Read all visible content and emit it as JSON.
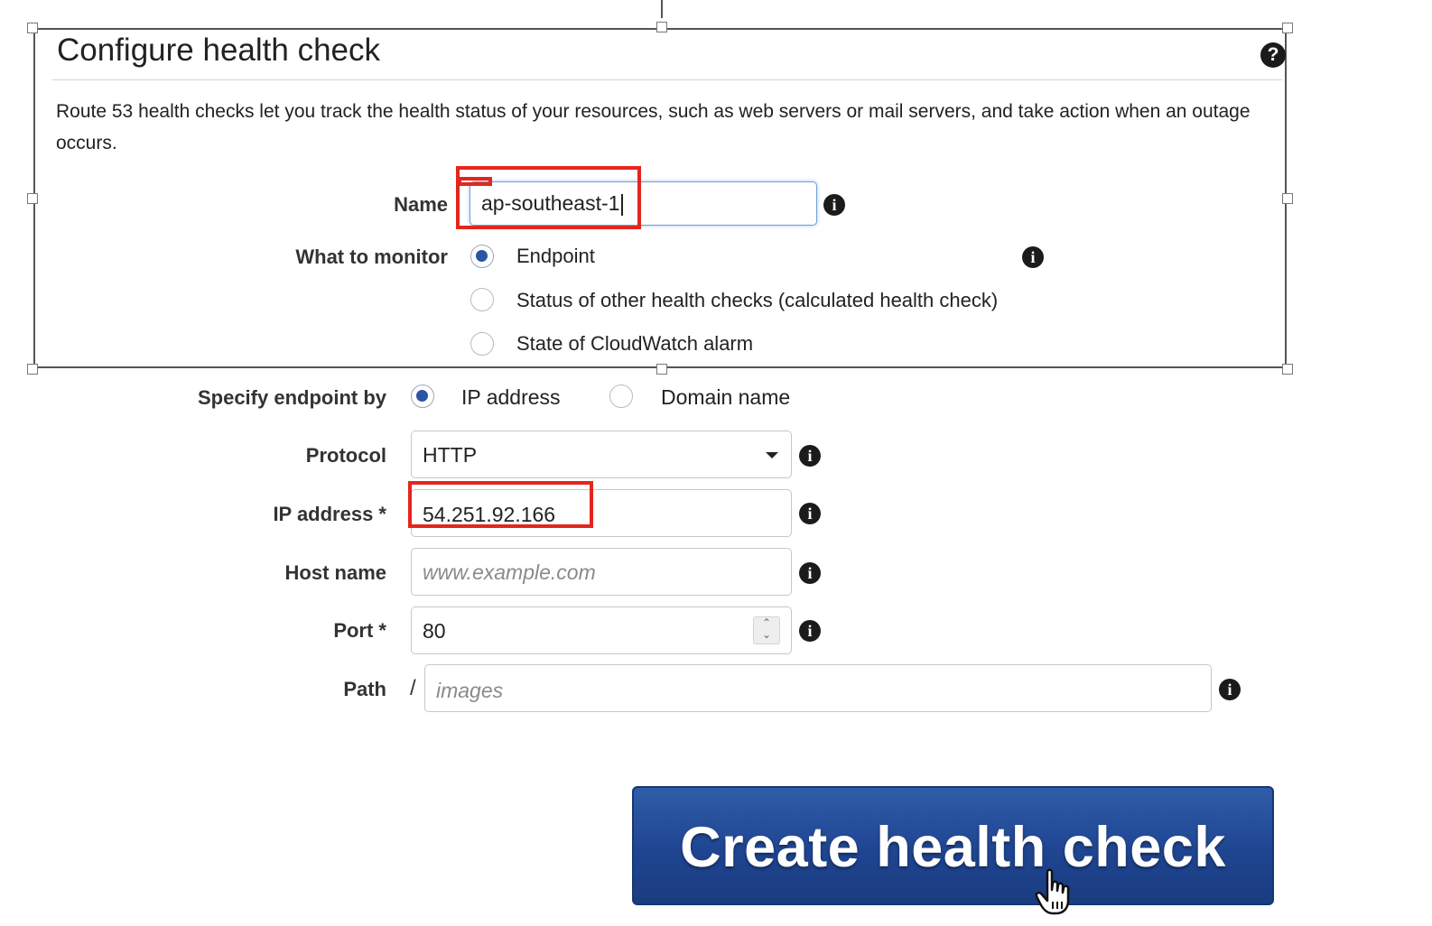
{
  "panel": {
    "title": "Configure health check",
    "description": "Route 53 health checks let you track the health status of your resources, such as web servers or mail servers, and take action when an outage occurs."
  },
  "form": {
    "name_label": "Name",
    "name_value": "ap-southeast-1",
    "monitor_label": "What to monitor",
    "monitor_options": [
      {
        "label": "Endpoint",
        "selected": true
      },
      {
        "label": "Status of other health checks (calculated health check)",
        "selected": false
      },
      {
        "label": "State of CloudWatch alarm",
        "selected": false
      }
    ],
    "endpoint_label": "Specify endpoint by",
    "endpoint_options": [
      {
        "label": "IP address",
        "selected": true
      },
      {
        "label": "Domain name",
        "selected": false
      }
    ],
    "protocol_label": "Protocol",
    "protocol_value": "HTTP",
    "ip_label": "IP address *",
    "ip_value": "54.251.92.166",
    "host_label": "Host name",
    "host_placeholder": "www.example.com",
    "port_label": "Port *",
    "port_value": "80",
    "path_label": "Path",
    "path_prefix": "/",
    "path_placeholder": "images"
  },
  "button": {
    "create_label": "Create health check"
  },
  "colors": {
    "highlight": "#e3261c",
    "button": "#1f4591",
    "radio_selected": "#2a55a6"
  },
  "icons": {
    "help": "question-circle-icon",
    "info": "info-circle-icon",
    "cursor": "hand-pointer-icon"
  }
}
